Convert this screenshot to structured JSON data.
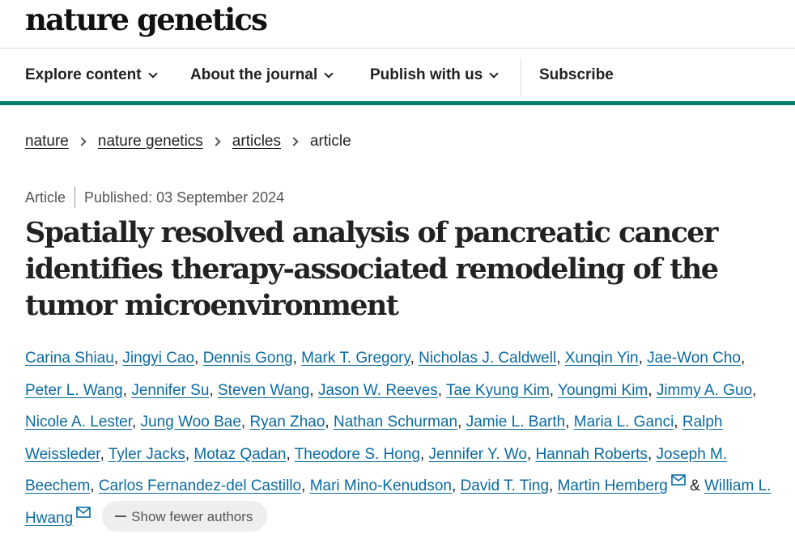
{
  "header": {
    "logo": "nature genetics"
  },
  "nav": {
    "items": [
      {
        "label": "Explore content",
        "dropdown": true
      },
      {
        "label": "About the journal",
        "dropdown": true
      },
      {
        "label": "Publish with us",
        "dropdown": true
      },
      {
        "label": "Subscribe",
        "dropdown": false
      }
    ]
  },
  "breadcrumb": {
    "items": [
      "nature",
      "nature genetics",
      "articles"
    ],
    "current": "article"
  },
  "article": {
    "type": "Article",
    "published": "Published: 03 September 2024",
    "title": "Spatially resolved analysis of pancreatic cancer identifies therapy-associated remodeling of the tumor microenvironment",
    "authors": [
      "Carina Shiau",
      "Jingyi Cao",
      "Dennis Gong",
      "Mark T. Gregory",
      "Nicholas J. Caldwell",
      "Xunqin Yin",
      "Jae-Won Cho",
      "Peter L. Wang",
      "Jennifer Su",
      "Steven Wang",
      "Jason W. Reeves",
      "Tae Kyung Kim",
      "Youngmi Kim",
      "Jimmy A. Guo",
      "Nicole A. Lester",
      "Jung Woo Bae",
      "Ryan Zhao",
      "Nathan Schurman",
      "Jamie L. Barth",
      "Maria L. Ganci",
      "Ralph Weissleder",
      "Tyler Jacks",
      "Motaz Qadan",
      "Theodore S. Hong",
      "Jennifer Y. Wo",
      "Hannah Roberts",
      "Joseph M. Beechem",
      "Carlos Fernandez-del Castillo",
      "Mari Mino-Kenudson",
      "David T. Ting",
      "Martin Hemberg",
      "William L. Hwang"
    ],
    "and_sign": "&",
    "show_fewer_label": "Show fewer authors"
  }
}
